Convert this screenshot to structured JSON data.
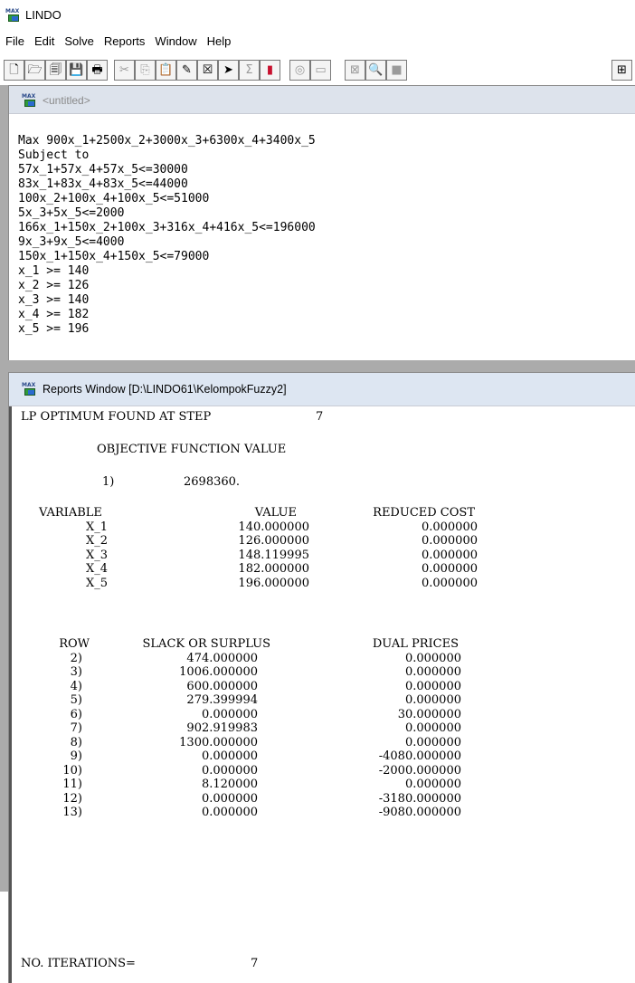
{
  "app": {
    "title": "LINDO",
    "icon": "lindo-app-icon",
    "icon_text": "MAX"
  },
  "menu": [
    "File",
    "Edit",
    "Solve",
    "Reports",
    "Window",
    "Help"
  ],
  "toolbar": [
    {
      "name": "new-icon",
      "glyph": "🗋"
    },
    {
      "name": "open-icon",
      "glyph": "🗁"
    },
    {
      "name": "view-icon",
      "glyph": "🗐"
    },
    {
      "name": "save-icon",
      "glyph": "💾"
    },
    {
      "name": "print-icon",
      "glyph": "🖶"
    },
    {
      "name": "cut-icon",
      "glyph": "✂"
    },
    {
      "name": "copy-icon",
      "glyph": "⎘"
    },
    {
      "name": "paste-icon",
      "glyph": "📋"
    },
    {
      "name": "find-icon",
      "glyph": "✎"
    },
    {
      "name": "close-box-icon",
      "glyph": "☒"
    },
    {
      "name": "goto-icon",
      "glyph": "➤"
    },
    {
      "name": "sum-icon",
      "glyph": "Σ"
    },
    {
      "name": "traffic-light-icon",
      "glyph": "▮"
    },
    {
      "name": "options-icon",
      "glyph": "◎"
    },
    {
      "name": "window-icon",
      "glyph": "▭"
    },
    {
      "name": "tile-icon",
      "glyph": "⊠"
    },
    {
      "name": "zoom-icon",
      "glyph": "🔍"
    },
    {
      "name": "stop-icon",
      "glyph": "■"
    },
    {
      "name": "network-icon",
      "glyph": "⊞"
    }
  ],
  "model_window": {
    "title": "<untitled>",
    "lines": [
      "Max 900x_1+2500x_2+3000x_3+6300x_4+3400x_5",
      "Subject to",
      "57x_1+57x_4+57x_5<=30000",
      "83x_1+83x_4+83x_5<=44000",
      "100x_2+100x_4+100x_5<=51000",
      "5x_3+5x_5<=2000",
      "166x_1+150x_2+100x_3+316x_4+416x_5<=196000",
      "9x_3+9x_5<=4000",
      "150x_1+150x_4+150x_5<=79000",
      "x_1 >= 140",
      "x_2 >= 126",
      "x_3 >= 140",
      "x_4 >= 182",
      "x_5 >= 196"
    ]
  },
  "reports_window": {
    "title": "Reports Window [D:\\LINDO61\\KelompokFuzzy2]",
    "header_label": "LP OPTIMUM FOUND AT STEP",
    "header_step": "7",
    "objective_label": "OBJECTIVE FUNCTION VALUE",
    "objective_row": "1)",
    "objective_value": "2698360.",
    "var_headers": [
      "VARIABLE",
      "VALUE",
      "REDUCED COST"
    ],
    "variables": [
      {
        "name": "X_1",
        "value": "140.000000",
        "reduced": "0.000000"
      },
      {
        "name": "X_2",
        "value": "126.000000",
        "reduced": "0.000000"
      },
      {
        "name": "X_3",
        "value": "148.119995",
        "reduced": "0.000000"
      },
      {
        "name": "X_4",
        "value": "182.000000",
        "reduced": "0.000000"
      },
      {
        "name": "X_5",
        "value": "196.000000",
        "reduced": "0.000000"
      }
    ],
    "row_headers": [
      "ROW",
      "SLACK OR SURPLUS",
      "DUAL PRICES"
    ],
    "rows": [
      {
        "row": "2)",
        "slack": "474.000000",
        "dual": "0.000000"
      },
      {
        "row": "3)",
        "slack": "1006.000000",
        "dual": "0.000000"
      },
      {
        "row": "4)",
        "slack": "600.000000",
        "dual": "0.000000"
      },
      {
        "row": "5)",
        "slack": "279.399994",
        "dual": "0.000000"
      },
      {
        "row": "6)",
        "slack": "0.000000",
        "dual": "30.000000"
      },
      {
        "row": "7)",
        "slack": "902.919983",
        "dual": "0.000000"
      },
      {
        "row": "8)",
        "slack": "1300.000000",
        "dual": "0.000000"
      },
      {
        "row": "9)",
        "slack": "0.000000",
        "dual": "-4080.000000"
      },
      {
        "row": "10)",
        "slack": "0.000000",
        "dual": "-2000.000000"
      },
      {
        "row": "11)",
        "slack": "8.120000",
        "dual": "0.000000"
      },
      {
        "row": "12)",
        "slack": "0.000000",
        "dual": "-3180.000000"
      },
      {
        "row": "13)",
        "slack": "0.000000",
        "dual": "-9080.000000"
      }
    ],
    "iterations_label": "NO. ITERATIONS=",
    "iterations_value": "7"
  },
  "colors": {
    "mdi_background": "#ababab",
    "caption_background": "#dde3ec"
  }
}
